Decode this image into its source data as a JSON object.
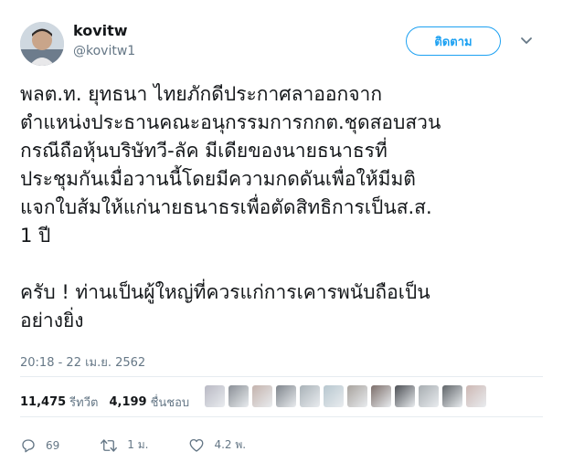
{
  "user": {
    "name": "kovitw",
    "handle": "@kovitw1"
  },
  "follow_label": "ติดตาม",
  "menu_icon": "chevron-down-icon",
  "tweet_text": "พลต.ท. ยุทธนา ไทยภักดีประกาศลาออกจาก\nตำแหน่งประธานคณะอนุกรรมการกกต.ชุดสอบสวน\nกรณีถือหุ้นบริษัทวี-ลัค มีเดียของนายธนาธรที่\nประชุมกันเมื่อวานนี้โดยมีความกดดันเพื่อให้มีมติ\nแจกใบส้มให้แก่นายธนาธรเพื่อตัดสิทธิการเป็นส.ส.\n1 ปี\n\nครับ ! ท่านเป็นผู้ใหญ่ที่ควรแก่การเคารพนับถือเป็น\nอย่างยิ่ง",
  "timestamp": "20:18 - 22 เม.ย. 2562",
  "stats": {
    "retweets_count": "11,475",
    "retweets_label": "รีทวีต",
    "likes_count": "4,199",
    "likes_label": "ชื่นชอบ"
  },
  "liker_avatars": [
    "#b9b9c4",
    "#8a8f96",
    "#c4b3ad",
    "#7f858c",
    "#a9b2b8",
    "#b7c7cf",
    "#a8a39e",
    "#7c6e6a",
    "#4c4f54",
    "#a7adb1",
    "#5f6468",
    "#cdb8b4"
  ],
  "actions": {
    "reply_count": "69",
    "retweet_count": "1 ม.",
    "like_count": "4.2 พ."
  },
  "colors": {
    "accent": "#1da1f2",
    "text": "#14171a",
    "muted": "#657786",
    "border": "#e6ecf0"
  }
}
